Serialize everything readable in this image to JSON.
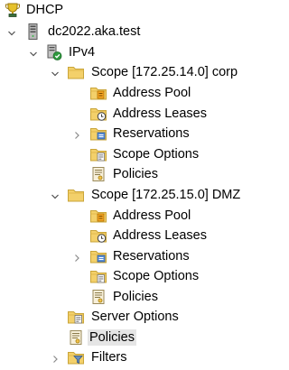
{
  "tree": {
    "root": {
      "label": "DHCP",
      "icon": "dhcp-trophy-icon"
    },
    "server": {
      "label": "dc2022.aka.test",
      "icon": "server-icon",
      "expanded": true
    },
    "ipv4": {
      "label": "IPv4",
      "icon": "ipv4-ok-icon",
      "expanded": true
    },
    "scope1": {
      "label": "Scope [172.25.14.0] corp",
      "icon": "folder-icon",
      "expanded": true,
      "children": [
        {
          "label": "Address Pool",
          "icon": "address-pool-icon"
        },
        {
          "label": "Address Leases",
          "icon": "address-leases-icon"
        },
        {
          "label": "Reservations",
          "icon": "reservations-icon",
          "expandable": true
        },
        {
          "label": "Scope Options",
          "icon": "scope-options-icon"
        },
        {
          "label": "Policies",
          "icon": "policies-icon"
        }
      ]
    },
    "scope2": {
      "label": "Scope [172.25.15.0] DMZ",
      "icon": "folder-icon",
      "expanded": true,
      "children": [
        {
          "label": "Address Pool",
          "icon": "address-pool-icon"
        },
        {
          "label": "Address Leases",
          "icon": "address-leases-icon"
        },
        {
          "label": "Reservations",
          "icon": "reservations-icon",
          "expandable": true
        },
        {
          "label": "Scope Options",
          "icon": "scope-options-icon"
        },
        {
          "label": "Policies",
          "icon": "policies-icon"
        }
      ]
    },
    "server_options": {
      "label": "Server Options",
      "icon": "server-options-icon"
    },
    "policies": {
      "label": "Policies",
      "icon": "policies-icon",
      "selected": true
    },
    "filters": {
      "label": "Filters",
      "icon": "filter-icon",
      "expandable": true
    }
  },
  "colors": {
    "folder": "#f3d06a",
    "folder_edge": "#c9a53a",
    "selection": "#e5e5e5",
    "chevron": "#707070"
  }
}
